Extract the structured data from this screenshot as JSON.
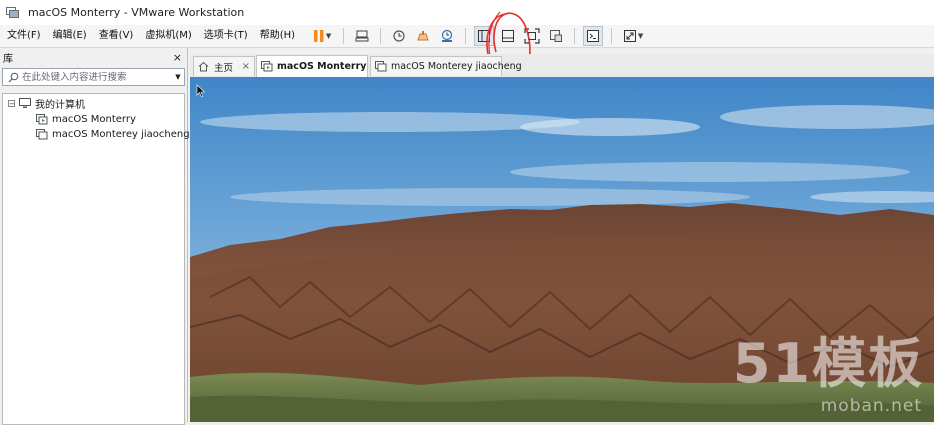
{
  "window": {
    "title": "macOS Monterry - VMware Workstation"
  },
  "menu": {
    "items": [
      {
        "label": "文件(F)"
      },
      {
        "label": "编辑(E)"
      },
      {
        "label": "查看(V)"
      },
      {
        "label": "虚拟机(M)"
      },
      {
        "label": "选项卡(T)"
      },
      {
        "label": "帮助(H)"
      }
    ]
  },
  "toolbar": {
    "buttons": [
      {
        "icon": "pause-icon",
        "has_dropdown": true
      },
      {
        "icon": "send-ctrl-alt-del-icon"
      },
      {
        "icon": "snapshot-icon"
      },
      {
        "icon": "revert-snapshot-icon"
      },
      {
        "icon": "snapshot-manager-icon"
      },
      {
        "icon": "show-library-icon"
      },
      {
        "icon": "thumbnail-bar-icon"
      },
      {
        "icon": "full-screen-icon"
      },
      {
        "icon": "unity-icon"
      },
      {
        "icon": "console-view-icon"
      },
      {
        "icon": "stretch-guest-icon",
        "has_dropdown": true
      }
    ],
    "accent_pause": "#f58a1f"
  },
  "library": {
    "header": "库",
    "close_label": "×",
    "search_placeholder": "在此处键入内容进行搜索",
    "tree": {
      "root": {
        "label": "我的计算机",
        "toggle": "−"
      },
      "children": [
        {
          "label": "macOS Monterry"
        },
        {
          "label": "macOS Monterey jiaocheng"
        }
      ]
    }
  },
  "tabs": [
    {
      "label": "主页",
      "icon": "home-icon"
    },
    {
      "label": "macOS Monterry",
      "icon": "vm-running-icon",
      "active": true
    },
    {
      "label": "macOS Monterey jiaocheng",
      "icon": "vm-icon"
    }
  ],
  "tab_close_label": "×",
  "watermark": {
    "big": "51模板",
    "small": "moban.net"
  },
  "colors": {
    "sky_top": "#3f86c8",
    "sky_bottom": "#a9c9e3",
    "mountain_dark": "#4a2f22",
    "mountain_mid": "#8a5a40",
    "foreground_green": "#6a7b45"
  }
}
